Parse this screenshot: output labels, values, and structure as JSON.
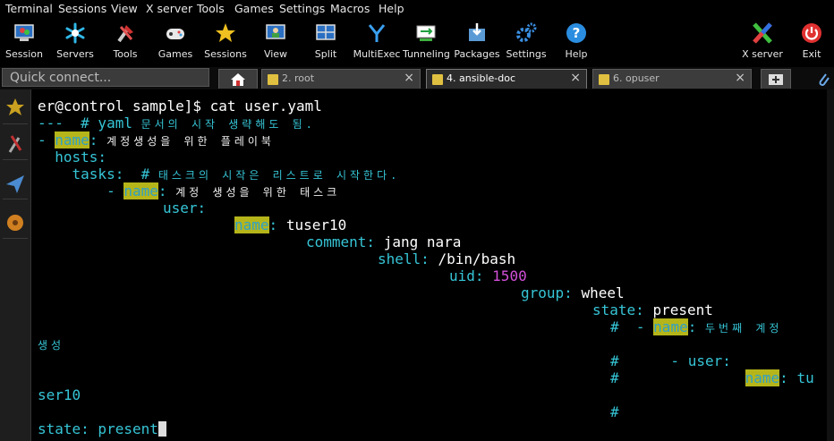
{
  "menubar": [
    "Terminal",
    "Sessions",
    "View",
    "X server",
    "Tools",
    "Games",
    "Settings",
    "Macros",
    "Help"
  ],
  "toolbar": {
    "session": "Session",
    "servers": "Servers",
    "tools": "Tools",
    "games": "Games",
    "sessions": "Sessions",
    "view": "View",
    "split": "Split",
    "multiexec": "MultiExec",
    "tunneling": "Tunneling",
    "packages": "Packages",
    "settings": "Settings",
    "help": "Help",
    "xserver": "X server",
    "exit": "Exit"
  },
  "quick_connect": "Quick connect...",
  "tabs": {
    "t1": "2. root",
    "t2": "4. ansible-doc",
    "t3": "6. opuser"
  },
  "term": {
    "l0": "er@control sample]$ cat user.yaml",
    "l1a": "---  # yaml ",
    "l1b": "문서의 시작 생략해도 됨.",
    "l2a": "- ",
    "l2b": "name",
    ":": ":",
    "l2c": "계정생성을 위한 플레이북",
    "l3": "  hosts:",
    "l4a": "    tasks:  # ",
    "l4b": "태스크의 시작은 리스트로 시작한다.",
    "l5a": "        - ",
    "l5b": "name",
    "l5c": "계정 생성을 위한 태스크",
    "l6": "user:",
    "l7a": "name",
    "l7b": "tuser10",
    "l8a": "comment:",
    "l8b": "jang nara",
    "l9a": "shell:",
    "l9b": "/bin/bash",
    "l10a": "uid:",
    "l10b": "1500",
    "l11a": "group:",
    "l11b": "wheel",
    "l12a": "state:",
    "l12b": "present",
    "l13a": "#  - ",
    "l13b": "name",
    "l13c": "두번째 계정",
    "l14": "생성",
    "l15": "#      - user:",
    "l16a": "#",
    "l16b": "name",
    "l16c": "tu",
    "l17": "ser10",
    "l18": "#",
    "l19": "state: present"
  }
}
